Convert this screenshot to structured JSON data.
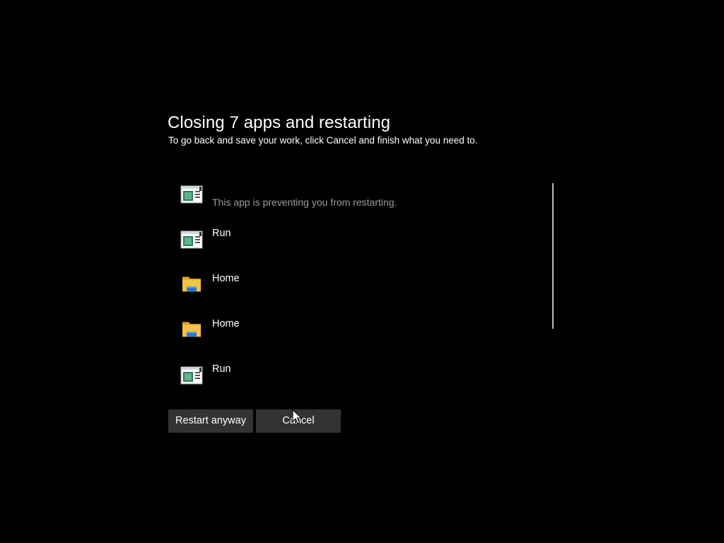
{
  "dialog": {
    "title": "Closing 7 apps and restarting",
    "subtitle": "To go back and save your work, click Cancel and finish what you need to."
  },
  "apps": [
    {
      "name": "",
      "note": "This app is preventing you from restarting.",
      "icon": "app-window-icon"
    },
    {
      "name": "Run",
      "icon": "app-window-icon"
    },
    {
      "name": "Home",
      "icon": "folder-icon"
    },
    {
      "name": "Home",
      "icon": "folder-icon"
    },
    {
      "name": "Run",
      "icon": "app-window-icon"
    }
  ],
  "buttons": {
    "restart_label": "Restart anyway",
    "cancel_label": "Cancel"
  },
  "colors": {
    "background": "#000000",
    "text": "#ffffff",
    "note_text": "#9a9a9a",
    "button_bg": "#333333",
    "folder_yellow": "#f6c344",
    "folder_blue": "#1f7bd6"
  }
}
